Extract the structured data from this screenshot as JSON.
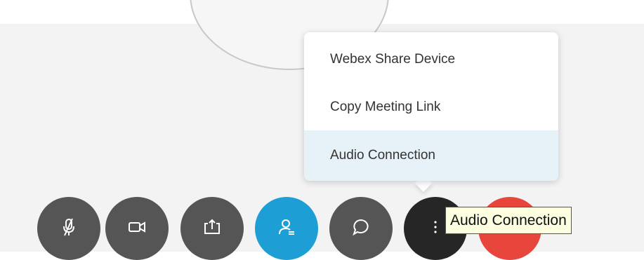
{
  "menu": {
    "items": [
      {
        "label": "Webex Share Device"
      },
      {
        "label": "Copy Meeting Link"
      },
      {
        "label": "Audio Connection"
      }
    ]
  },
  "tooltip": {
    "text": "Audio Connection"
  },
  "controls": [
    {
      "icon": "mic-muted-icon",
      "color": "#555555"
    },
    {
      "icon": "video-icon",
      "color": "#555555"
    },
    {
      "icon": "share-icon",
      "color": "#555555"
    },
    {
      "icon": "participants-icon",
      "color": "#1d9fd6"
    },
    {
      "icon": "chat-icon",
      "color": "#555555"
    },
    {
      "icon": "more-options-icon",
      "color": "#262626"
    },
    {
      "icon": "end-call-icon",
      "color": "#e8453c"
    }
  ]
}
